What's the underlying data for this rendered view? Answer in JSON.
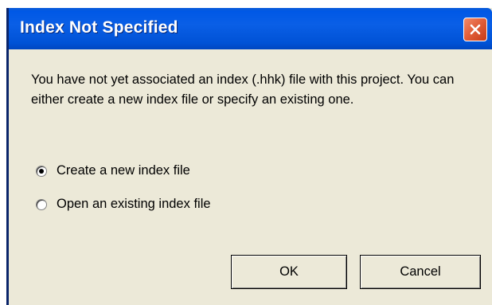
{
  "dialog": {
    "title": "Index Not Specified",
    "message": "You have not yet associated an index (.hhk) file with this project. You can either create a new index file or specify an existing one.",
    "options": [
      {
        "label": "Create a new index file",
        "selected": true
      },
      {
        "label": "Open an existing index file",
        "selected": false
      }
    ],
    "ok_label": "OK",
    "cancel_label": "Cancel"
  },
  "icons": {
    "close": "close-icon",
    "radio": "radio-button"
  },
  "colors": {
    "titlebar": "#0058e6",
    "window_bg": "#ece9d8",
    "close_button": "#e2603c"
  }
}
